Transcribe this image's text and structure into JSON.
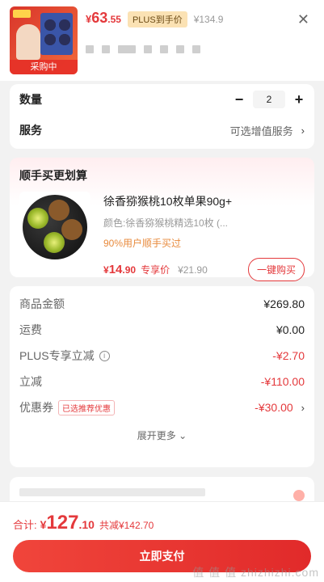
{
  "header": {
    "product_badge": "采购中",
    "price_currency": "¥",
    "price_main": "63",
    "price_decimal": ".55",
    "plus_tag": "PLUS到手价",
    "original_price": "¥134.9",
    "close_icon": "close-icon"
  },
  "quantity": {
    "label": "数量",
    "minus": "−",
    "value": "2",
    "plus": "+"
  },
  "service": {
    "label": "服务",
    "value": "可选增值服务",
    "chevron": "›"
  },
  "combo": {
    "title": "顺手买更划算",
    "product_name": "徐香猕猴桃10枚单果90g+",
    "color_text": "颜色:徐香猕猴桃精选10枚 (...",
    "percent_text": "90%用户顺手买过",
    "price_currency": "¥",
    "price_main": "14",
    "price_decimal": ".90",
    "price_label": "专享价",
    "original_price": "¥21.90",
    "buy_button": "一键购买"
  },
  "summary": {
    "rows": [
      {
        "label": "商品金额",
        "value": "¥269.80"
      },
      {
        "label": "运费",
        "value": "¥0.00"
      },
      {
        "label": "PLUS专享立减",
        "value": "-¥2.70"
      },
      {
        "label": "立减",
        "value": "-¥110.00"
      },
      {
        "label": "优惠券",
        "tag": "已选推荐优惠",
        "value": "-¥30.00"
      }
    ],
    "expand_text": "展开更多 ⌄"
  },
  "footer": {
    "total_label": "合计:",
    "total_currency": "¥",
    "total_main": "127",
    "total_decimal": ".10",
    "total_saving": "共减¥142.70",
    "pay_button": "立即支付",
    "watermark": "值 值 值 zhizhizhi.com"
  },
  "colors": {
    "accent": "#e4393c",
    "plus_tag_bg": "#fbe2b4"
  }
}
